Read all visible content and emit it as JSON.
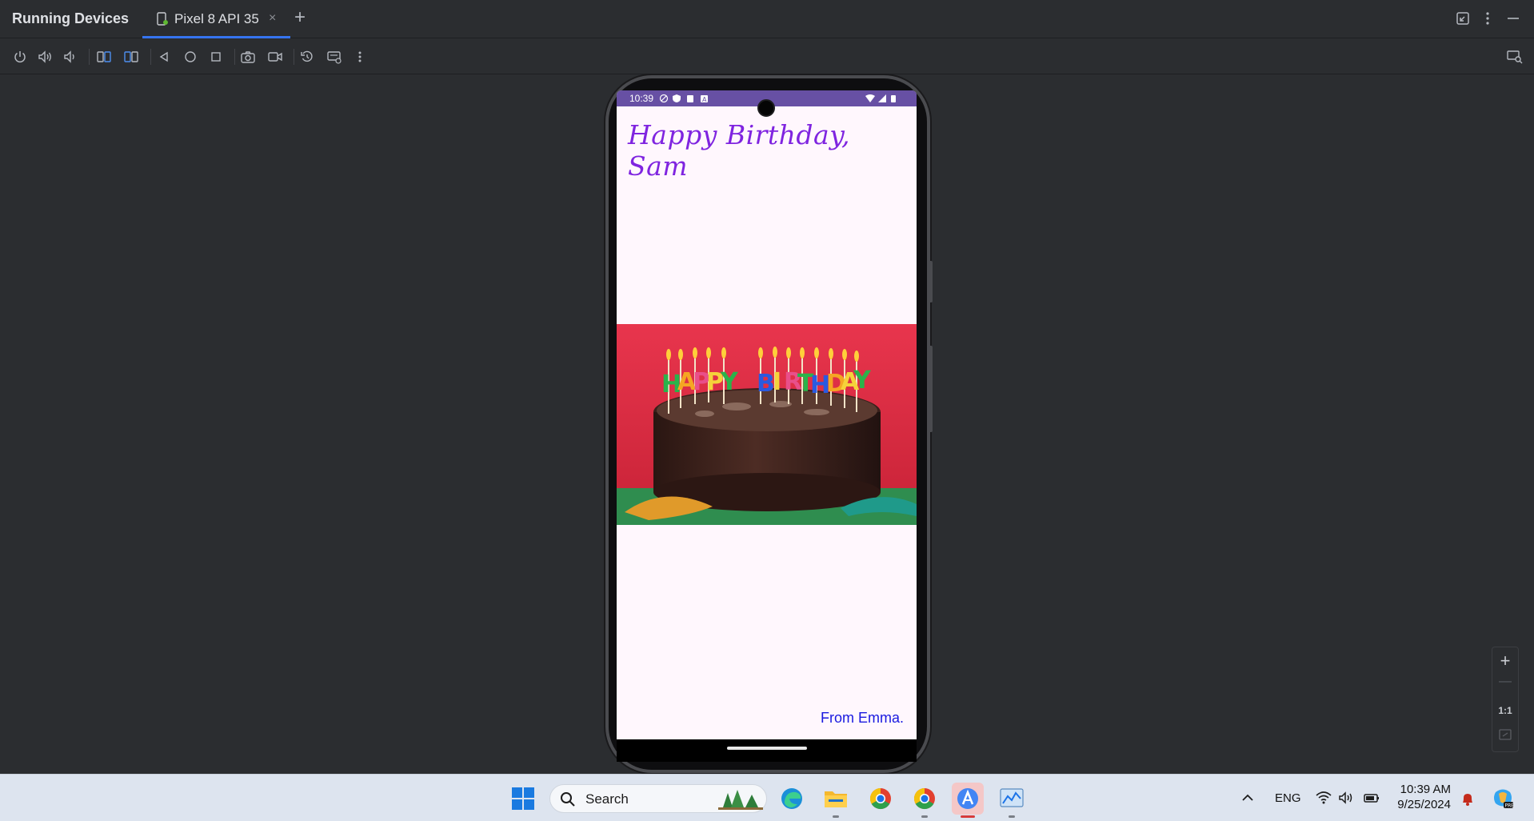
{
  "header": {
    "title": "Running Devices",
    "tab_label": "Pixel 8 API 35",
    "close_glyph": "×",
    "add_glyph": "+"
  },
  "toolbar": {
    "buttons": [
      "power-icon",
      "volume-up-icon",
      "volume-down-icon",
      "rotate-left-icon",
      "rotate-right-icon",
      "back-icon",
      "home-icon",
      "overview-icon",
      "screenshot-icon",
      "screen-record-icon",
      "reset-icon",
      "device-settings-icon",
      "more-options-icon"
    ]
  },
  "phone": {
    "status_time": "10:39",
    "greeting": "Happy Birthday, Sam",
    "signature": "From Emma.",
    "cake_letters": [
      "H",
      "A",
      "P",
      "P",
      "Y",
      "B",
      "I",
      "R",
      "T",
      "H",
      "D",
      "A",
      "Y"
    ]
  },
  "zoom": {
    "zoom_in": "+",
    "zoom_out": "—",
    "actual_size": "1:1"
  },
  "taskbar": {
    "search_placeholder": "Search",
    "language": "ENG",
    "time": "10:39 AM",
    "date": "9/25/2024"
  },
  "colors": {
    "accent": "#3574f0",
    "status_bar": "#6750a4",
    "greeting": "#7f24e0",
    "signature": "#1a1ae0"
  }
}
